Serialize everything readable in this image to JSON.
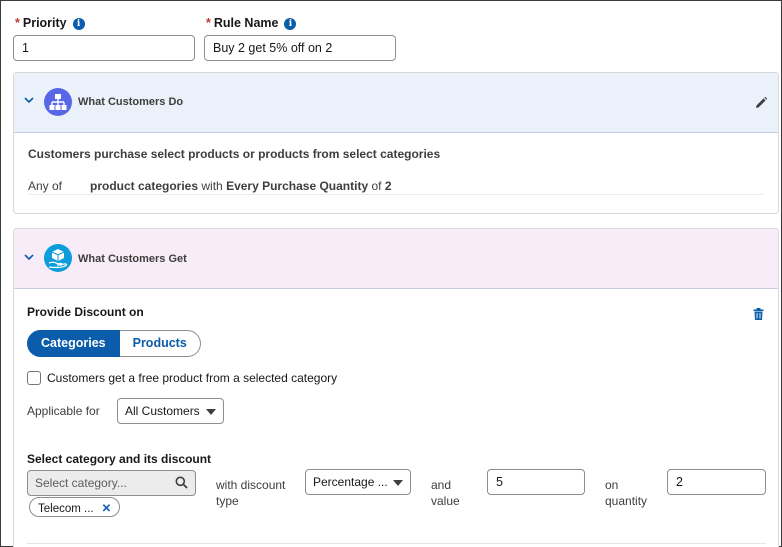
{
  "priority": {
    "label": "Priority",
    "required_mark": "*",
    "value": "1"
  },
  "rule_name": {
    "label": "Rule Name",
    "required_mark": "*",
    "value": "Buy 2 get 5% off on 2"
  },
  "info_glyph": "i",
  "what_do": {
    "title": "What Customers Do",
    "icon": "hierarchy-icon",
    "header_color": "#eaf1fb",
    "description": "Customers purchase select products or products from select categories",
    "condition": {
      "prefix": "Any of",
      "target": "product categories",
      "with": "with",
      "measure": "Every Purchase Quantity",
      "of": "of",
      "quantity": "2"
    }
  },
  "what_get": {
    "title": "What Customers Get",
    "icon": "box-in-hand-icon",
    "header_color": "#f8ecf8",
    "provide_label": "Provide Discount on",
    "tabs": [
      "Categories",
      "Products"
    ],
    "selected_tab": "Categories",
    "free_product_label": "Customers get a free product from a selected category",
    "free_product_checked": false,
    "applicable_label": "Applicable for",
    "applicable_value": "All Customers",
    "section_label": "Select category and its discount",
    "search_placeholder": "Select category...",
    "selected_pill": "Telecom ...",
    "pill_remove_glyph": "✕",
    "discount_type_label_1": "with discount",
    "discount_type_label_2": "type",
    "discount_type_value": "Percentage ...",
    "value_label_1": "and",
    "value_label_2": "value",
    "value": "5",
    "quantity_label_1": "on",
    "quantity_label_2": "quantity",
    "quantity": "2"
  },
  "colors": {
    "brand": "#0b5cab",
    "icon_bg_do": "#5867e8",
    "icon_bg_get": "#0d9dda",
    "required": "#c23934"
  }
}
